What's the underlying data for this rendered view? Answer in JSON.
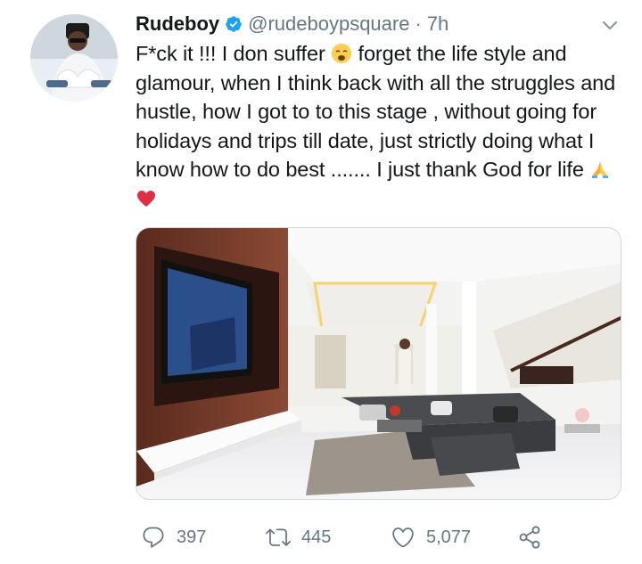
{
  "tweet": {
    "author": {
      "name": "Rudeboy",
      "handle": "@rudeboypsquare",
      "separator": "·",
      "time": "7h",
      "avatar_icon": "avatar-photo",
      "verified_icon": "verified-badge-icon"
    },
    "text": {
      "part1": "F*ck it !!! I don suffer ",
      "emoji1": "weary-face-emoji",
      "part2": " forget the life style and glamour, when I think back with all the struggles and hustle, how I got to to this stage , without going for holidays and trips till date, just strictly doing what I know how to do best ....... I just thank God for life ",
      "emoji2": "folded-hands-emoji",
      "emoji3": "red-heart-emoji"
    },
    "media": {
      "type": "photo",
      "icon": "living-room-photo"
    },
    "actions": {
      "reply_count": "397",
      "retweet_count": "445",
      "like_count": "5,077"
    }
  },
  "colors": {
    "text": "#14171a",
    "muted": "#657786",
    "verified": "#1da1f2",
    "border": "#ccd6dd"
  }
}
